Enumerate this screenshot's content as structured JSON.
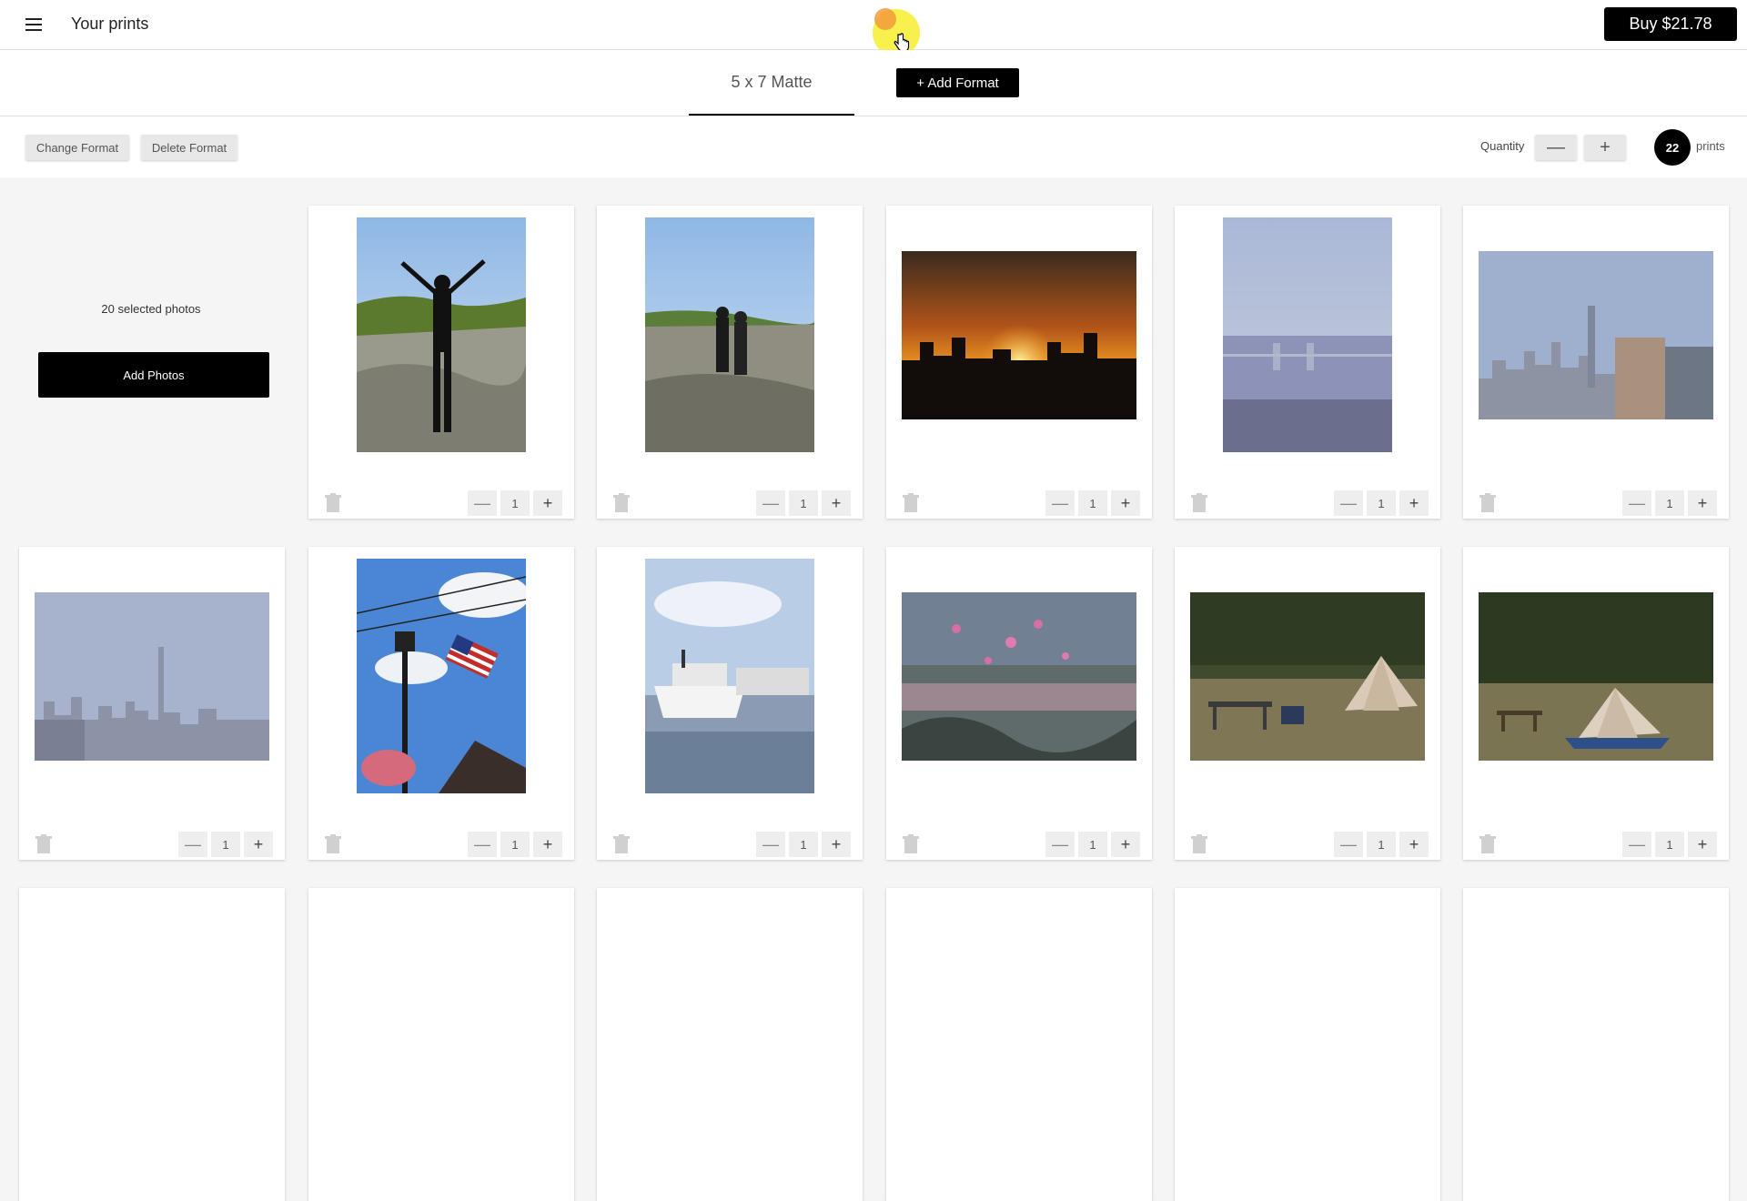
{
  "header": {
    "title": "Your prints",
    "buy_label": "Buy $21.78"
  },
  "format_tabs": {
    "active": "5 x 7 Matte",
    "add_label": "+ Add Format"
  },
  "toolbar": {
    "change_label": "Change Format",
    "delete_label": "Delete Format",
    "quantity_label": "Quantity",
    "minus": "—",
    "plus": "+",
    "count": "22",
    "count_label": "prints"
  },
  "left_panel": {
    "selected_text": "20 selected photos",
    "add_photos_label": "Add Photos"
  },
  "cards": [
    {
      "photo": "hiker-arms-raised",
      "orientation": "portrait",
      "quantity": "1"
    },
    {
      "photo": "two-hikers-summit",
      "orientation": "portrait",
      "quantity": "1"
    },
    {
      "photo": "city-sunset",
      "orientation": "landscape",
      "quantity": "1"
    },
    {
      "photo": "hazy-bridge-water",
      "orientation": "portrait",
      "quantity": "1"
    },
    {
      "photo": "city-skyline",
      "orientation": "landscape",
      "quantity": "1"
    },
    {
      "photo": "hazy-manhattan-skyline",
      "orientation": "landscape",
      "quantity": "1"
    },
    {
      "photo": "lamppost-american-flag",
      "orientation": "portrait",
      "quantity": "1"
    },
    {
      "photo": "boats-at-dock",
      "orientation": "portrait",
      "quantity": "1"
    },
    {
      "photo": "pink-flowers-double-exposure",
      "orientation": "landscape",
      "quantity": "1"
    },
    {
      "photo": "campsite-tent",
      "orientation": "landscape",
      "quantity": "1"
    },
    {
      "photo": "tent-in-clearing",
      "orientation": "landscape",
      "quantity": "1"
    }
  ],
  "stepper": {
    "minus": "—",
    "plus": "+"
  },
  "colors": {
    "primary": "#000000",
    "background": "#f5f5f5",
    "card": "#ffffff",
    "cursor_highlight": "#f7ef3a"
  }
}
